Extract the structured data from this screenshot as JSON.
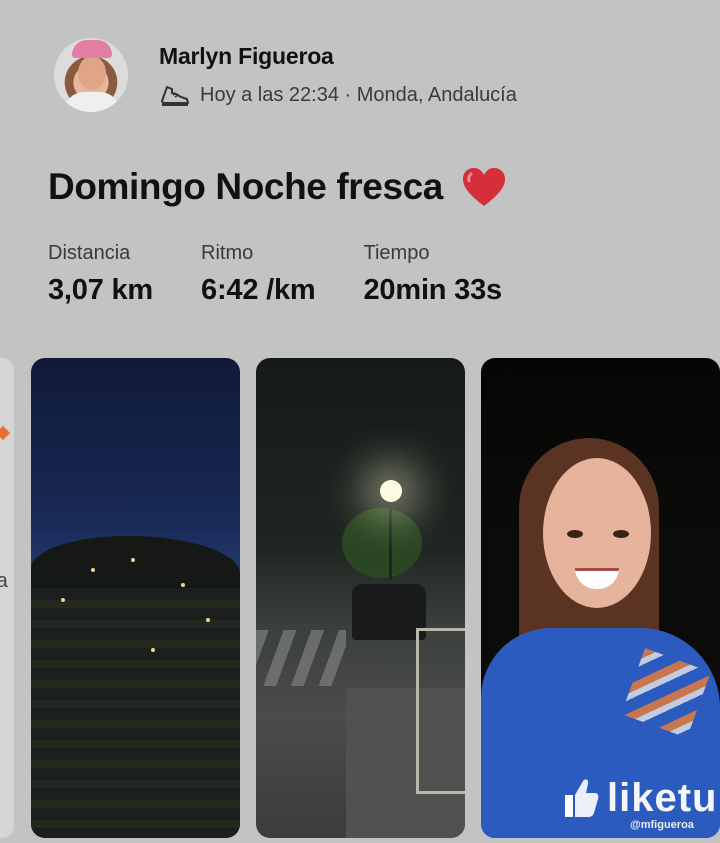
{
  "post": {
    "author": "Marlyn Figueroa",
    "meta": "Hoy a las 22:34 · Monda, Andalucía",
    "activity_icon": "running-shoe-icon",
    "title": "Domingo Noche fresca",
    "title_emoji": "heart-icon",
    "accent_heart_color": "#d62e3a"
  },
  "stats": [
    {
      "label": "Distancia",
      "value": "3,07 km"
    },
    {
      "label": "Ritmo",
      "value": "6:42 /km"
    },
    {
      "label": "Tiempo",
      "value": "20min 33s"
    }
  ],
  "map_peek": {
    "text": "ra"
  },
  "watermark": {
    "brand": "liketu",
    "handle": "@mfigueroa"
  }
}
